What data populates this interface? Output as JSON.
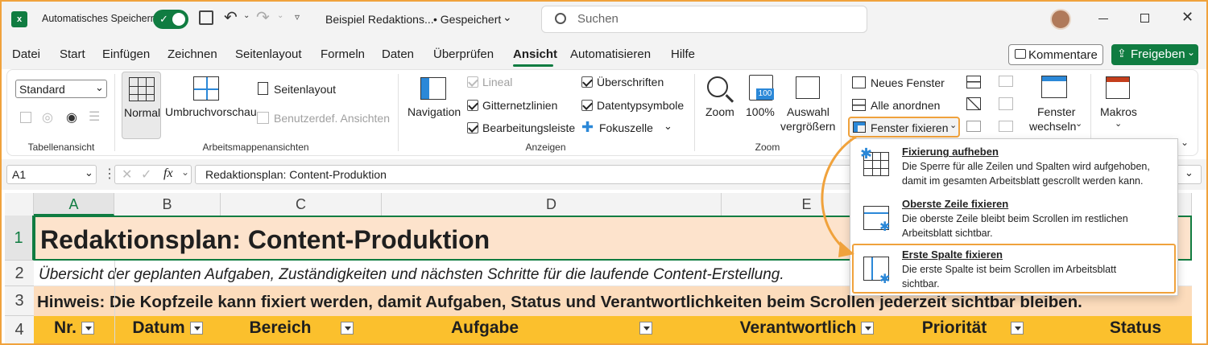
{
  "titlebar": {
    "autosave_label": "Automatisches Speichern",
    "doc_title": "Beispiel Redaktions...",
    "save_state": "• Gespeichert",
    "search_placeholder": "Suchen"
  },
  "menu": [
    "Datei",
    "Start",
    "Einfügen",
    "Zeichnen",
    "Seitenlayout",
    "Formeln",
    "Daten",
    "Überprüfen",
    "Ansicht",
    "Automatisieren",
    "Hilfe"
  ],
  "menu_active": "Ansicht",
  "actions": {
    "comments": "Kommentare",
    "share": "Freigeben"
  },
  "ribbon": {
    "sheetview": {
      "dropdown": "Standard",
      "group": "Tabellenansicht"
    },
    "workbookviews": {
      "normal": "Normal",
      "pagebreak": "Umbruchvorschau",
      "pagelayout": "Seitenlayout",
      "custom": "Benutzerdef. Ansichten",
      "group": "Arbeitsmappenansichten"
    },
    "show": {
      "navigation": "Navigation",
      "ruler": "Lineal",
      "gridlines": "Gitternetzlinien",
      "formulabar": "Bearbeitungsleiste",
      "headings": "Überschriften",
      "datatype": "Datentypsymbole",
      "focuscell": "Fokuszelle",
      "group": "Anzeigen"
    },
    "zoom": {
      "zoom": "Zoom",
      "hundred": "100%",
      "sel1": "Auswahl",
      "sel2": "vergrößern",
      "group": "Zoom"
    },
    "window": {
      "newwin": "Neues Fenster",
      "arrange": "Alle anordnen",
      "freeze": "Fenster fixieren",
      "switch1": "Fenster",
      "switch2": "wechseln"
    },
    "macros": {
      "label": "Makros"
    }
  },
  "formula": {
    "namebox": "A1",
    "fx": "fx",
    "content": "Redaktionsplan: Content-Produktion"
  },
  "columns": [
    "A",
    "B",
    "C",
    "D",
    "E"
  ],
  "rows": [
    "1",
    "2",
    "3",
    "4"
  ],
  "sheet": {
    "title": "Redaktionsplan: Content-Produktion",
    "subtitle": "Übersicht der geplanten Aufgaben, Zuständigkeiten und nächsten Schritte für die laufende Content-Erstellung.",
    "hint": "Hinweis: Die Kopfzeile kann fixiert werden, damit Aufgaben, Status und Verantwortlichkeiten beim Scrollen jederzeit sichtbar bleiben.",
    "headers": [
      "Nr.",
      "Datum",
      "Bereich",
      "Aufgabe",
      "Verantwortlich",
      "Priorität",
      "Status"
    ]
  },
  "freeze_menu": [
    {
      "title": "Fixierung aufheben",
      "desc1": "Die Sperre für alle Zeilen und Spalten wird aufgehoben,",
      "desc2": "damit im gesamten Arbeitsblatt gescrollt werden kann."
    },
    {
      "title": "Oberste Zeile fixieren",
      "desc1": "Die oberste Zeile bleibt beim Scrollen im restlichen",
      "desc2": "Arbeitsblatt sichtbar."
    },
    {
      "title": "Erste Spalte fixieren",
      "desc1": "Die erste Spalte ist beim Scrollen im Arbeitsblatt",
      "desc2": "sichtbar."
    }
  ],
  "colors": {
    "accent": "#f0a23c",
    "excel_green": "#107c41",
    "header_fill": "#fbc02d",
    "title_fill": "#fde3cc",
    "hint_fill": "#fcdcbc"
  }
}
